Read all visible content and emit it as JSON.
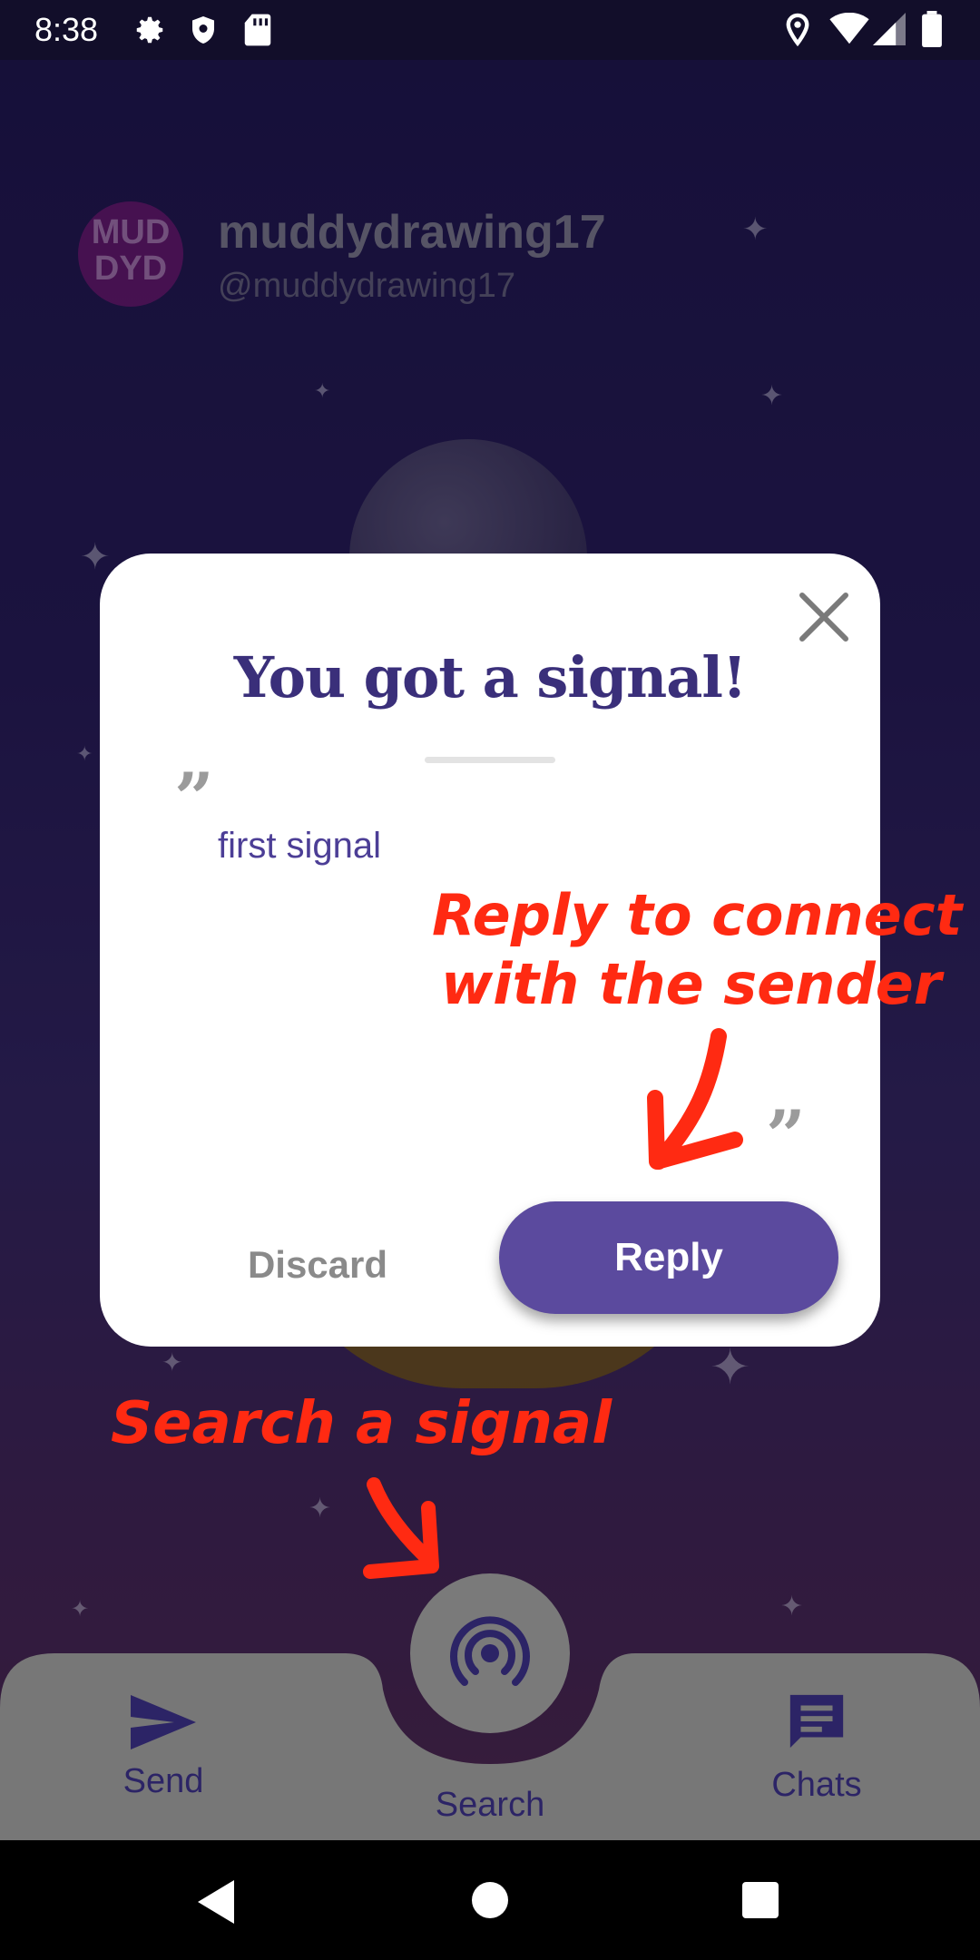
{
  "status_bar": {
    "time": "8:38"
  },
  "profile": {
    "avatar_text_line1": "MUD",
    "avatar_text_line2": "DYD",
    "username": "muddydrawing17",
    "handle": "@muddydrawing17"
  },
  "dialog": {
    "title": "You got a signal!",
    "message": "first signal",
    "open_quote": "”",
    "close_quote": "”",
    "discard_label": "Discard",
    "reply_label": "Reply"
  },
  "annotations": {
    "reply_hint_line1": "Reply to connect",
    "reply_hint_line2": "with the sender",
    "search_hint": "Search a signal"
  },
  "bottom_nav": {
    "items": [
      {
        "label": "Send",
        "icon": "send-icon"
      },
      {
        "label": "Search",
        "icon": "signal-radar-icon"
      },
      {
        "label": "Chats",
        "icon": "chat-icon"
      }
    ]
  },
  "colors": {
    "accent": "#5b4a9e",
    "title": "#3a2f7a",
    "annotation": "#ff2a12"
  }
}
